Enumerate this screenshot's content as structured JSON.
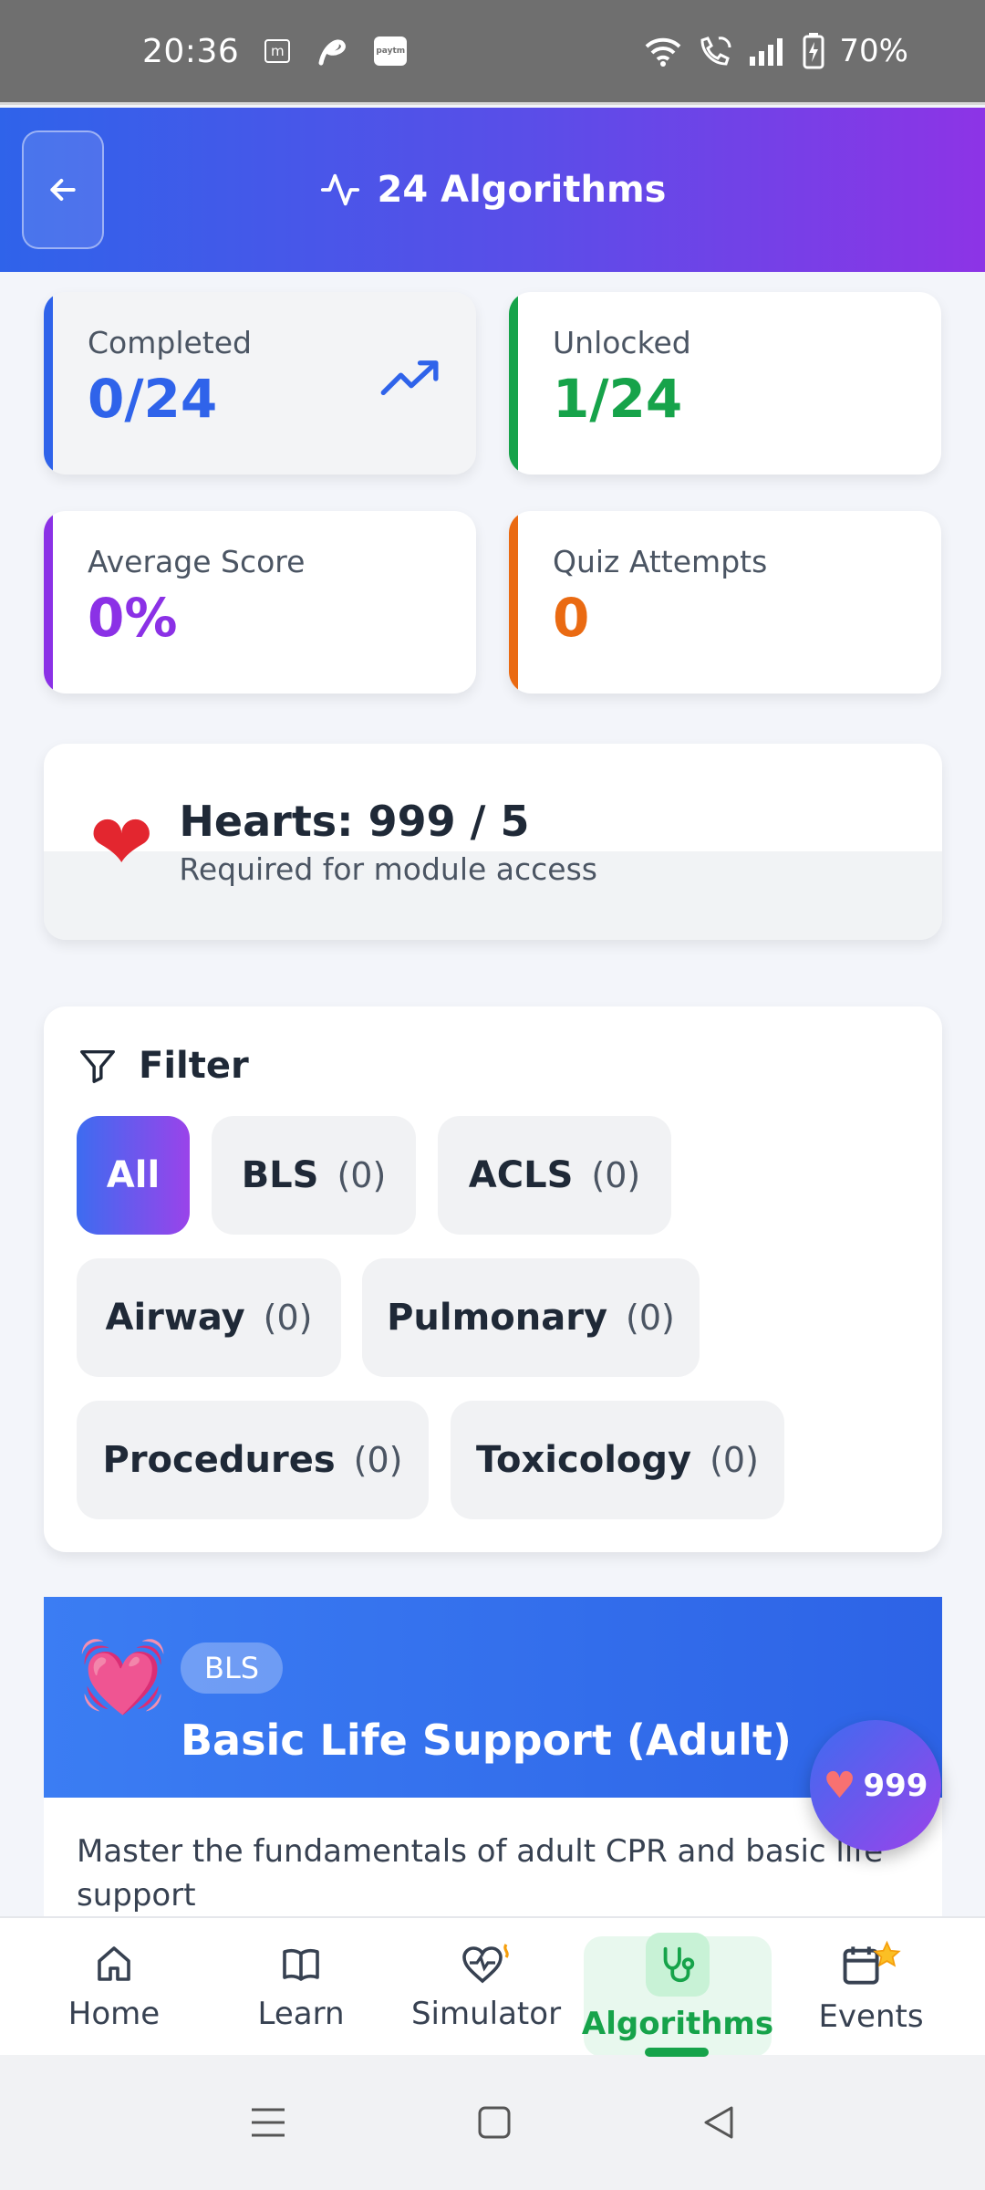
{
  "status_bar": {
    "time": "20:36",
    "battery": "70%",
    "icons": [
      "m-icon",
      "airtel-icon",
      "paytm-icon",
      "wifi-icon",
      "wifi-call-icon",
      "signal-icon",
      "battery-charging-icon"
    ]
  },
  "header": {
    "title": "24 Algorithms",
    "back_icon": "arrow-left-icon",
    "title_icon": "activity-icon"
  },
  "stats": {
    "completed": {
      "label": "Completed",
      "value": "0/24",
      "color": "#2f63ea"
    },
    "unlocked": {
      "label": "Unlocked",
      "value": "1/24",
      "color": "#16a34a"
    },
    "average_score": {
      "label": "Average Score",
      "value": "0%",
      "color": "#8b31e6"
    },
    "quiz_attempts": {
      "label": "Quiz Attempts",
      "value": "0",
      "color": "#ea6a12"
    }
  },
  "hearts": {
    "title": "Hearts: 999 / 5",
    "subtitle": "Required for module access"
  },
  "filter": {
    "title": "Filter",
    "chips": [
      {
        "label": "All",
        "count": "",
        "active": true
      },
      {
        "label": "BLS",
        "count": "(0)"
      },
      {
        "label": "ACLS",
        "count": "(0)"
      },
      {
        "label": "Airway",
        "count": "(0)"
      },
      {
        "label": "Pulmonary",
        "count": "(0)"
      },
      {
        "label": "Procedures",
        "count": "(0)"
      },
      {
        "label": "Toxicology",
        "count": "(0)"
      }
    ]
  },
  "module": {
    "badge": "BLS",
    "title": "Basic Life Support (Adult)",
    "description": "Master the fundamentals of adult CPR and basic life support"
  },
  "fab": {
    "count": "999"
  },
  "bottom_nav": {
    "items": [
      {
        "label": "Home",
        "icon": "home-icon"
      },
      {
        "label": "Learn",
        "icon": "book-icon"
      },
      {
        "label": "Simulator",
        "icon": "heart-pulse-icon"
      },
      {
        "label": "Algorithms",
        "icon": "stethoscope-icon",
        "active": true
      },
      {
        "label": "Events",
        "icon": "calendar-icon"
      }
    ]
  }
}
